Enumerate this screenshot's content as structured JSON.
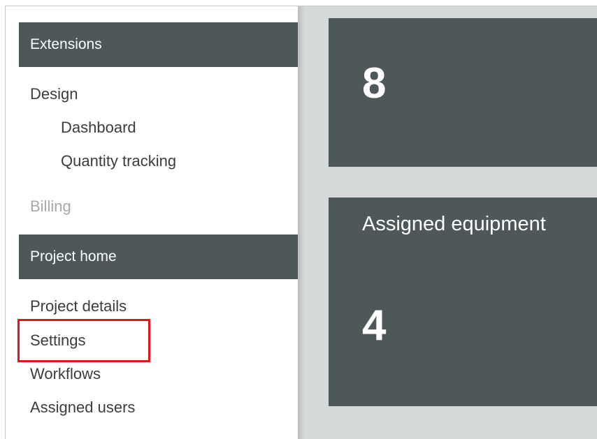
{
  "sidebar": {
    "extensions_header": "Extensions",
    "design": "Design",
    "dashboard": "Dashboard",
    "quantity_tracking": "Quantity tracking",
    "billing": "Billing",
    "project_home_header": "Project home",
    "project_details": "Project details",
    "settings": "Settings",
    "workflows": "Workflows",
    "assigned_users": "Assigned users"
  },
  "cards": [
    {
      "title": "",
      "value": "8"
    },
    {
      "title": "Assigned equipment",
      "value": "4"
    }
  ],
  "colors": {
    "header_bg": "#4f5859",
    "card_bg": "#4f5859",
    "main_bg": "#d6d9d9",
    "highlight": "#e3141b",
    "disabled_text": "#a7a9ab"
  }
}
